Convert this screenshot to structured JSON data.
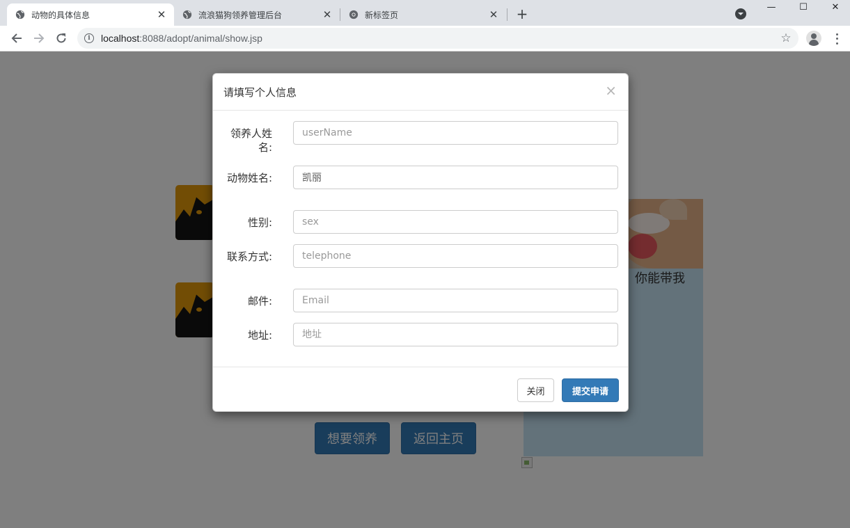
{
  "browser": {
    "tabs": [
      {
        "title": "动物的具体信息",
        "icon": "globe-icon",
        "active": true
      },
      {
        "title": "流浪猫狗领养管理后台",
        "icon": "globe-icon",
        "active": false
      },
      {
        "title": "新标签页",
        "icon": "chrome-icon",
        "active": false
      }
    ],
    "tab_close_glyph": "✕",
    "new_tab_glyph": "+",
    "window_controls": {
      "minimize": "—",
      "maximize": "☐",
      "close": "✕"
    },
    "address": {
      "host": "localhost",
      "rest": ":8088/adopt/animal/show.jsp"
    }
  },
  "page": {
    "side_caption": "你能带我",
    "buttons": {
      "adopt": "想要领养",
      "home": "返回主页"
    }
  },
  "modal": {
    "title": "请填写个人信息",
    "close_glyph": "×",
    "fields": [
      {
        "label": "领养人姓名:",
        "value": "",
        "placeholder": "userName"
      },
      {
        "label": "动物姓名:",
        "value": "凯丽",
        "placeholder": ""
      },
      {
        "label": "性别:",
        "value": "",
        "placeholder": "sex"
      },
      {
        "label": "联系方式:",
        "value": "",
        "placeholder": "telephone"
      },
      {
        "label": "邮件:",
        "value": "",
        "placeholder": "Email"
      },
      {
        "label": "地址:",
        "value": "",
        "placeholder": "地址"
      }
    ],
    "footer": {
      "close_label": "关闭",
      "submit_label": "提交申请"
    }
  },
  "colors": {
    "primary": "#337ab7",
    "backdrop": "rgba(0,0,0,0.5)",
    "tab_strip": "#dee1e6"
  }
}
